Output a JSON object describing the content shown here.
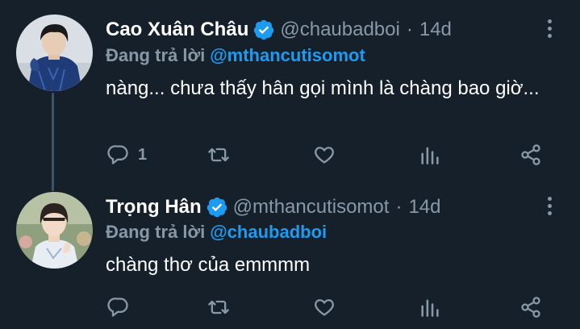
{
  "colors": {
    "background": "#15202b",
    "text": "#ffffff",
    "muted": "#8899a6",
    "accent": "#1d9bf0",
    "thread_line": "#3d5466"
  },
  "tweets": [
    {
      "display_name": "Cao Xuân Châu",
      "verified": true,
      "handle": "@chaubadboi",
      "separator": "·",
      "time": "14d",
      "reply_prefix": "Đang trả lời",
      "reply_to": "@mthancutisomot",
      "text": "nàng... chưa thấy hân gọi mình là chàng bao giờ...",
      "reply_count": "1",
      "icons": [
        "reply-icon",
        "retweet-icon",
        "like-icon",
        "analytics-icon",
        "share-icon",
        "more-icon"
      ]
    },
    {
      "display_name": "Trọng Hân",
      "verified": true,
      "handle": "@mthancutisomot",
      "separator": "·",
      "time": "14d",
      "reply_prefix": "Đang trả lời",
      "reply_to": "@chaubadboi",
      "text": "chàng thơ của emmmm",
      "reply_count": "",
      "icons": [
        "reply-icon",
        "retweet-icon",
        "like-icon",
        "analytics-icon",
        "share-icon",
        "more-icon"
      ]
    }
  ]
}
